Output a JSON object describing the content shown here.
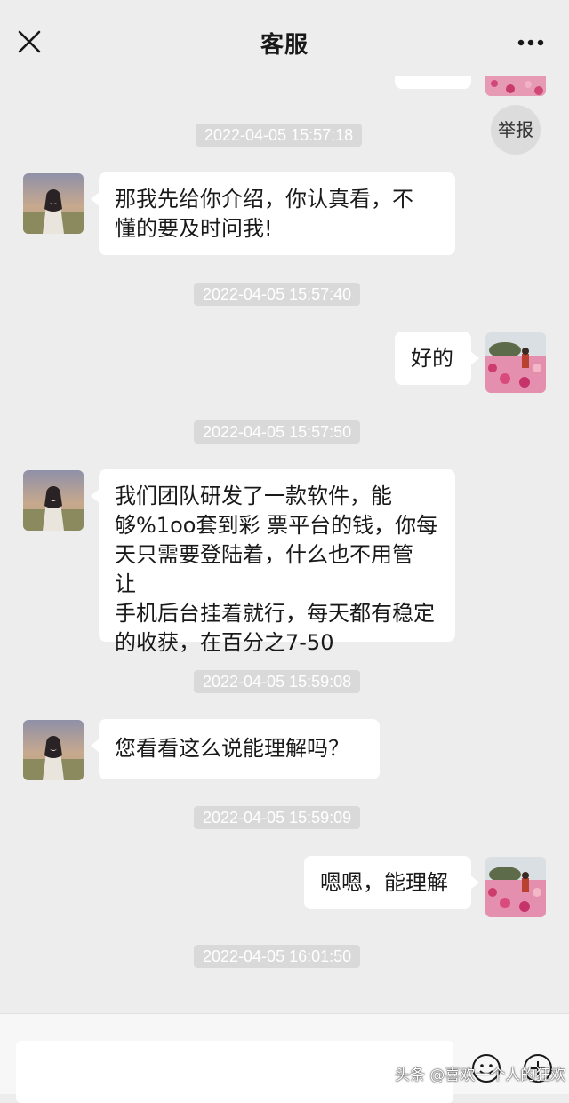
{
  "header": {
    "title": "客服",
    "close_icon": "close-icon",
    "more_icon": "more-horizontal-icon"
  },
  "report_label": "举报",
  "messages": [
    {
      "type": "text",
      "side": "left",
      "text": "那我先给你介绍，你认真看，不\n懂的要及时问我!"
    },
    {
      "type": "text",
      "side": "right",
      "text": "好的"
    },
    {
      "type": "text",
      "side": "left",
      "text": "我们团队研发了一款软件，能\n够%1oo套到彩 票平台的钱，你每\n天只需要登陆着，什么也不用管 让\n手机后台挂着就行，每天都有稳定\n的收获，在百分之7-50"
    },
    {
      "type": "text",
      "side": "left",
      "text": "您看看这么说能理解吗？"
    },
    {
      "type": "text",
      "side": "right",
      "text": "嗯嗯，能理解"
    }
  ],
  "timestamps": [
    "2022-04-05 15:57:18",
    "2022-04-05 15:57:40",
    "2022-04-05 15:57:50",
    "2022-04-05 15:59:08",
    "2022-04-05 15:59:09",
    "2022-04-05 16:01:50"
  ],
  "input": {
    "value": "",
    "placeholder": ""
  },
  "bottom_icons": [
    "emoji-icon",
    "plus-circle-icon"
  ],
  "watermark": "头条 @喜欢一个人的狂欢",
  "colors": {
    "background": "#ededed",
    "bubble": "#ffffff",
    "timestamp_bg": "#d9d9d9",
    "timestamp_text": "#ffffff"
  }
}
